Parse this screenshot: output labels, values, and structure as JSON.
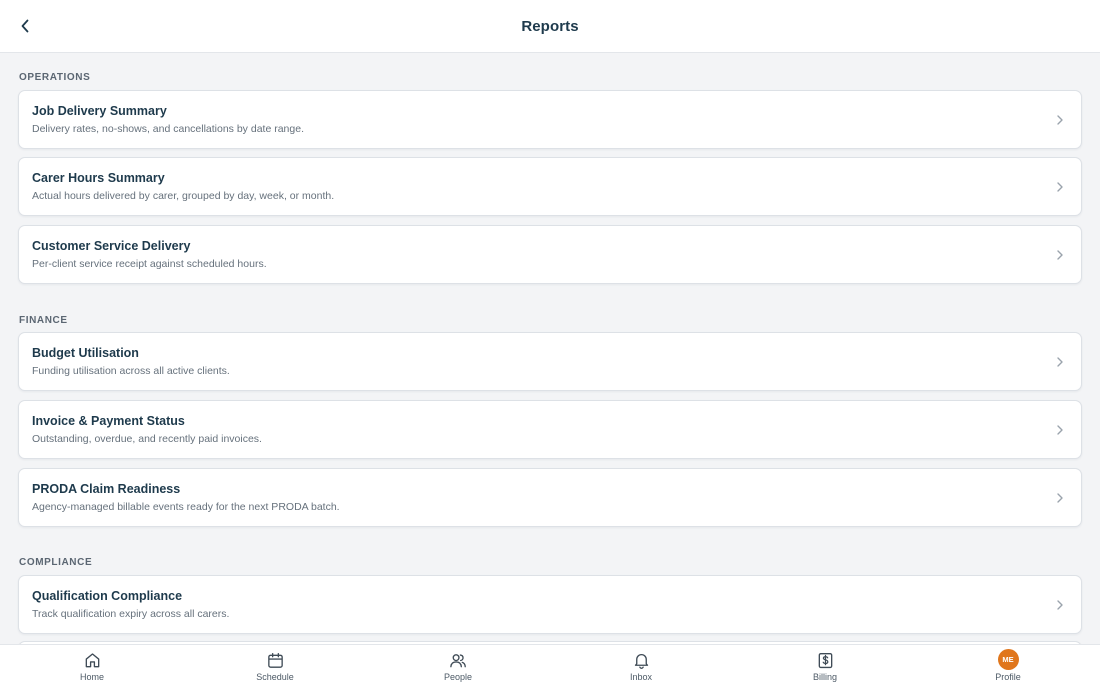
{
  "header": {
    "title": "Reports"
  },
  "colors": {
    "accent": "#e0761c",
    "title_text": "#1e3a4c",
    "muted_text": "#66717c"
  },
  "sections": [
    {
      "label": "OPERATIONS",
      "items": [
        {
          "title": "Job Delivery Summary",
          "description": "Delivery rates, no-shows, and cancellations by date range."
        },
        {
          "title": "Carer Hours Summary",
          "description": "Actual hours delivered by carer, grouped by day, week, or month."
        },
        {
          "title": "Customer Service Delivery",
          "description": "Per-client service receipt against scheduled hours."
        }
      ]
    },
    {
      "label": "FINANCE",
      "items": [
        {
          "title": "Budget Utilisation",
          "description": "Funding utilisation across all active clients."
        },
        {
          "title": "Invoice & Payment Status",
          "description": "Outstanding, overdue, and recently paid invoices."
        },
        {
          "title": "PRODA Claim Readiness",
          "description": "Agency-managed billable events ready for the next PRODA batch."
        }
      ]
    },
    {
      "label": "COMPLIANCE",
      "items": [
        {
          "title": "Qualification Compliance",
          "description": "Track qualification expiry across all carers."
        }
      ]
    }
  ],
  "tabs": [
    {
      "label": "Home",
      "icon": "home-icon"
    },
    {
      "label": "Schedule",
      "icon": "calendar-icon"
    },
    {
      "label": "People",
      "icon": "people-icon"
    },
    {
      "label": "Inbox",
      "icon": "bell-icon"
    },
    {
      "label": "Billing",
      "icon": "dollar-receipt-icon"
    },
    {
      "label": "Profile",
      "icon": "avatar",
      "avatar_initials": "ME"
    }
  ]
}
